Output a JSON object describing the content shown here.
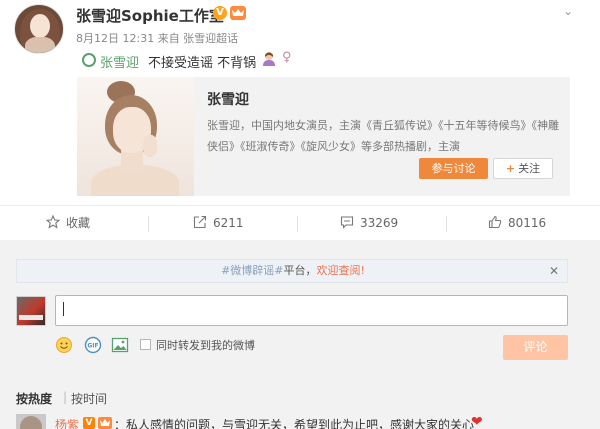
{
  "post": {
    "account_name": "张雪迎Sophie工作室",
    "verified_mark": "V",
    "vip_badge": "VIP",
    "meta": "8月12日 12:31 来自 张雪迎超话",
    "mention": "张雪迎",
    "body_text": "不接受造谣 不背锅"
  },
  "card": {
    "title": "张雪迎",
    "description": "张雪迎，中国内地女演员，主演《青丘狐传说》《十五年等待候鸟》《神雕侠侣》《班淑传奇》《旋风少女》等多部热播剧，主演",
    "join_label": "参与讨论",
    "follow_label": "关注"
  },
  "actions": {
    "favorite_label": "收藏",
    "repost_count": "6211",
    "comment_count": "33269",
    "like_count": "80116"
  },
  "comment": {
    "notice_hash": "#微博辟谣#",
    "notice_text": "平台，",
    "notice_link": "欢迎查阅!",
    "repost_checkbox_label": "同时转发到我的微博",
    "submit_label": "评论",
    "sort_hot": "按热度",
    "sort_sep": "|",
    "sort_time": "按时间"
  },
  "reply": {
    "name": "杨紫",
    "badge_v": "V",
    "badge_vip": "VIP",
    "text": "：私人感情的问题，与雪迎无关，希望到此为止吧，感谢大家的关心"
  },
  "colors": {
    "accent_orange": "#f0883c",
    "link_green": "#5aa06c",
    "link_orange": "#eb7350",
    "heart_red": "#e0322f"
  }
}
